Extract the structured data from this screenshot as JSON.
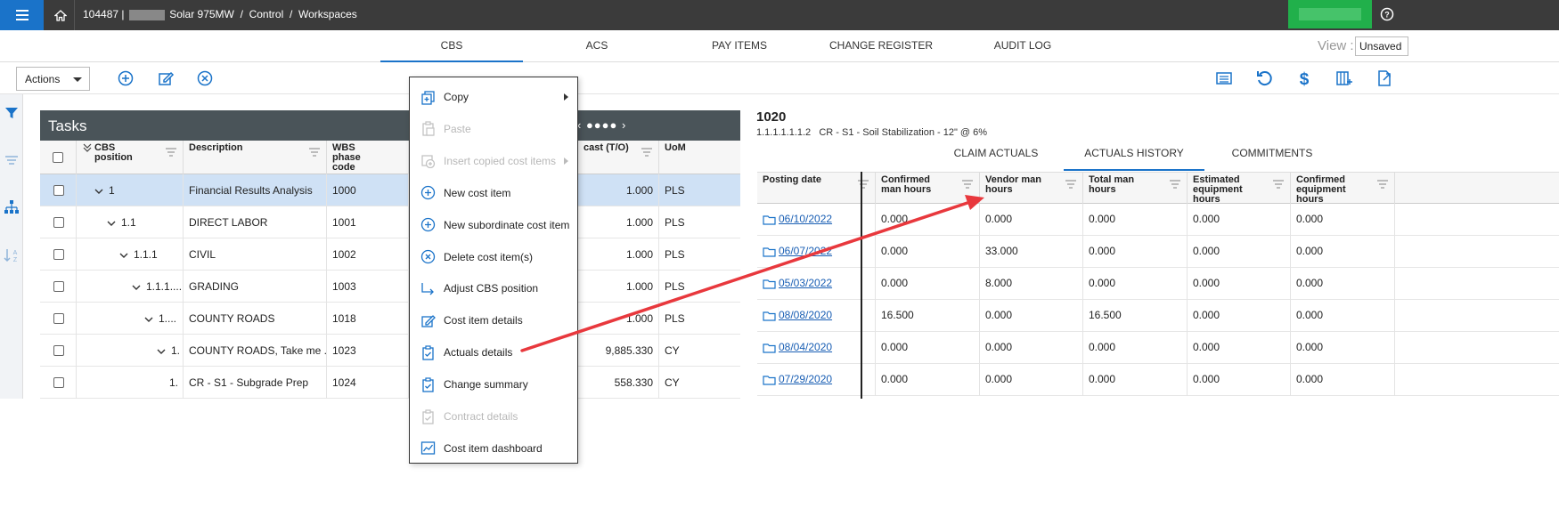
{
  "topbar": {
    "project_id": "104487 |",
    "project_name": "Solar 975MW",
    "sep1": "/",
    "crumb2": "Control",
    "sep2": "/",
    "crumb3": "Workspaces"
  },
  "tabs": [
    {
      "label": "CBS",
      "active": true
    },
    {
      "label": "ACS",
      "active": false
    },
    {
      "label": "PAY ITEMS",
      "active": false
    },
    {
      "label": "CHANGE REGISTER",
      "active": false
    },
    {
      "label": "AUDIT LOG",
      "active": false
    }
  ],
  "view": {
    "label": "View :",
    "value": "Unsaved"
  },
  "toolbar": {
    "actions_label": "Actions"
  },
  "tasks": {
    "title": "Tasks",
    "pager": "‹ ●●●● ›",
    "columns": {
      "cbs": "CBS position",
      "desc": "Description",
      "wbs": "WBS phase code",
      "forecast": "cast (T/O)",
      "uom": "UoM"
    },
    "rows": [
      {
        "cbs": "1",
        "desc": "Financial Results Analysis",
        "wbs": "1000",
        "forecast": "1.000",
        "uom": "PLS"
      },
      {
        "cbs": "1.1",
        "desc": "DIRECT LABOR",
        "wbs": "1001",
        "forecast": "1.000",
        "uom": "PLS"
      },
      {
        "cbs": "1.1.1",
        "desc": "CIVIL",
        "wbs": "1002",
        "forecast": "1.000",
        "uom": "PLS"
      },
      {
        "cbs": "1.1.1....",
        "desc": "GRADING",
        "wbs": "1003",
        "forecast": "1.000",
        "uom": "PLS"
      },
      {
        "cbs": "1....",
        "desc": "COUNTY ROADS",
        "wbs": "1018",
        "forecast": "1.000",
        "uom": "PLS"
      },
      {
        "cbs": "1.",
        "desc": "COUNTY ROADS, Take me ...",
        "wbs": "1023",
        "forecast": "9,885.330",
        "uom": "CY"
      },
      {
        "cbs": "1.",
        "desc": "CR - S1 - Subgrade Prep",
        "wbs": "1024",
        "forecast": "558.330",
        "uom": "CY"
      }
    ]
  },
  "context_menu": [
    {
      "label": "Copy",
      "icon": "copy-icon",
      "disabled": false,
      "submenu": true
    },
    {
      "label": "Paste",
      "icon": "paste-icon",
      "disabled": true,
      "submenu": false
    },
    {
      "label": "Insert copied cost items",
      "icon": "insert-icon",
      "disabled": true,
      "submenu": true
    },
    {
      "label": "New cost item",
      "icon": "plus-circle-icon",
      "disabled": false,
      "submenu": false
    },
    {
      "label": "New subordinate cost item",
      "icon": "plus-circle-icon",
      "disabled": false,
      "submenu": false
    },
    {
      "label": "Delete cost item(s)",
      "icon": "x-circle-icon",
      "disabled": false,
      "submenu": false
    },
    {
      "label": "Adjust CBS position",
      "icon": "adjust-arrow-icon",
      "disabled": false,
      "submenu": false
    },
    {
      "label": "Cost item details",
      "icon": "edit-icon",
      "disabled": false,
      "submenu": false
    },
    {
      "label": "Actuals details",
      "icon": "clipboard-icon",
      "disabled": false,
      "submenu": false
    },
    {
      "label": "Change summary",
      "icon": "clipboard-icon",
      "disabled": false,
      "submenu": false
    },
    {
      "label": "Contract details",
      "icon": "clipboard-icon",
      "disabled": true,
      "submenu": false
    },
    {
      "label": "Cost item dashboard",
      "icon": "dashboard-icon",
      "disabled": false,
      "submenu": false
    }
  ],
  "detail": {
    "title": "1020",
    "code": "1.1.1.1.1.1.2",
    "description": "CR - S1 - Soil Stabilization - 12\" @ 6%",
    "tabs": [
      {
        "label": "CLAIM ACTUALS",
        "active": false
      },
      {
        "label": "ACTUALS HISTORY",
        "active": true
      },
      {
        "label": "COMMITMENTS",
        "active": false
      }
    ],
    "columns": {
      "posting_date": "Posting date",
      "confirmed_man": "Confirmed man hours",
      "vendor_man": "Vendor man hours",
      "total_man": "Total man hours",
      "est_equipment": "Estimated equipment hours",
      "conf_equipment": "Confirmed equipment hours"
    },
    "rows": [
      {
        "date": "06/10/2022",
        "confirmed_man": "0.000",
        "vendor_man": "0.000",
        "total_man": "0.000",
        "est_equipment": "0.000",
        "conf_equipment": "0.000"
      },
      {
        "date": "06/07/2022",
        "confirmed_man": "0.000",
        "vendor_man": "33.000",
        "total_man": "0.000",
        "est_equipment": "0.000",
        "conf_equipment": "0.000"
      },
      {
        "date": "05/03/2022",
        "confirmed_man": "0.000",
        "vendor_man": "8.000",
        "total_man": "0.000",
        "est_equipment": "0.000",
        "conf_equipment": "0.000"
      },
      {
        "date": "08/08/2020",
        "confirmed_man": "16.500",
        "vendor_man": "0.000",
        "total_man": "16.500",
        "est_equipment": "0.000",
        "conf_equipment": "0.000"
      },
      {
        "date": "08/04/2020",
        "confirmed_man": "0.000",
        "vendor_man": "0.000",
        "total_man": "0.000",
        "est_equipment": "0.000",
        "conf_equipment": "0.000"
      },
      {
        "date": "07/29/2020",
        "confirmed_man": "0.000",
        "vendor_man": "0.000",
        "total_man": "0.000",
        "est_equipment": "0.000",
        "conf_equipment": "0.000"
      }
    ]
  },
  "colors": {
    "accent": "#1a73c9",
    "topbar": "#3b3b3b",
    "selected_row": "#cfe1f5",
    "annotation_arrow": "#e8383d",
    "brand_green": "#21b04b"
  }
}
